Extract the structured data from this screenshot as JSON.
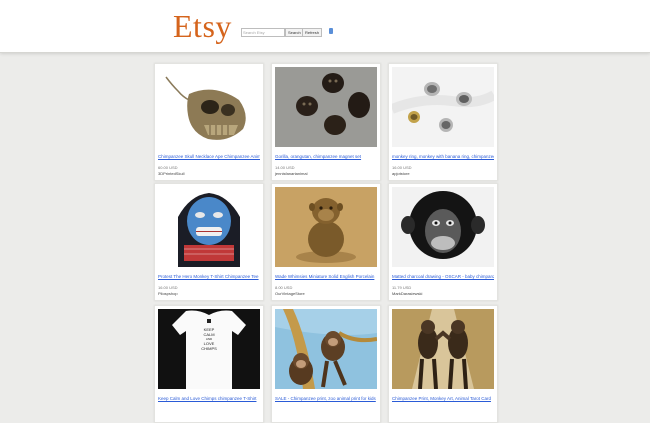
{
  "header": {
    "logo": "Etsy",
    "search_placeholder": "Search Etsy",
    "search_label": "Search",
    "refresh_label": "Refresh"
  },
  "listings": [
    {
      "title": "Chimpanzee Skull Necklace Ape Chimpanzee Animal",
      "price": "60.00 USD",
      "shop": "3DPrintedSkull"
    },
    {
      "title": "Gorilla, orangutan, chimpanzee magnet set",
      "price": "14.00 USD",
      "shop": "jennisfanartanimal"
    },
    {
      "title": "monkey ring, monkey with banana ring, chimpanzee",
      "price": "16.00 USD",
      "shop": "apjotstore"
    },
    {
      "title": "Protest The Hero Monkey T-Shirt Chimpanzee Tee",
      "price": "16.00 USD",
      "shop": "Pilospshop"
    },
    {
      "title": "Wade Whimsies Miniature Solid English Porcelain",
      "price": "8.00 USD",
      "shop": "OurVintageStore"
    },
    {
      "title": "Matted charcoal drawing - OSCAR - baby chimpanzee",
      "price": "11.79 USD",
      "shop": "MarkDarasiewski"
    },
    {
      "title": "Keep Calm and Love Chimps chimpanzee T-Shirt",
      "price": "",
      "shop": ""
    },
    {
      "title": "SALE - Chimpanzee print, zoo animal print for kids",
      "price": "",
      "shop": ""
    },
    {
      "title": "Chimpanzee Print, Monkey Art, Animal Tarot Card",
      "price": "",
      "shop": ""
    }
  ],
  "tshirt_text": [
    "KEEP",
    "CALM",
    "AND",
    "LOVE",
    "CHIMPS"
  ]
}
